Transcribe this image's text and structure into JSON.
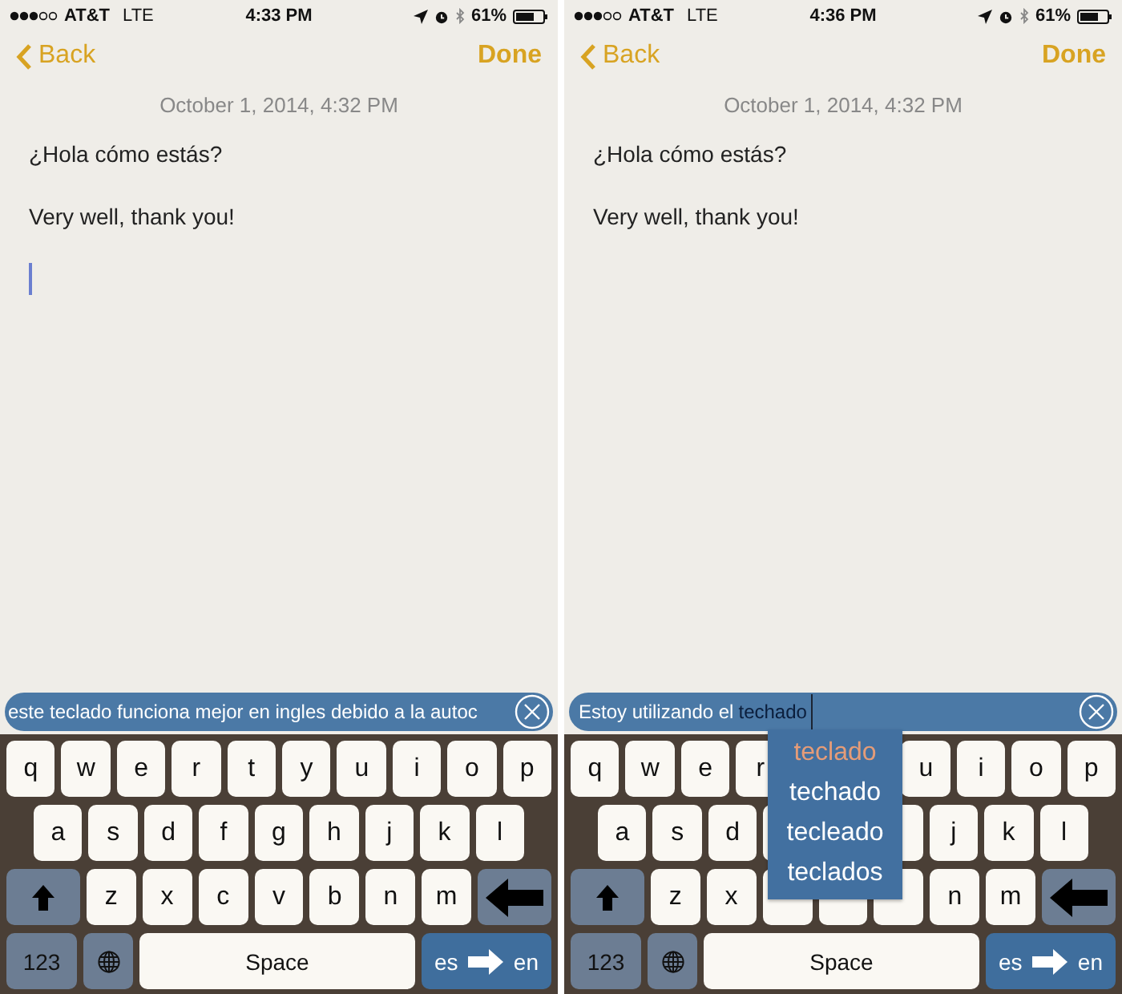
{
  "phones": [
    {
      "status": {
        "carrier": "AT&T",
        "network": "LTE",
        "time": "4:33 PM",
        "battery": "61%"
      },
      "nav": {
        "back": "Back",
        "done": "Done"
      },
      "date": "October 1, 2014, 4:32 PM",
      "lines": [
        "¿Hola cómo estás?",
        "Very well, thank you!"
      ],
      "text_cursor": true,
      "suggestion_bar": {
        "text": "este teclado funciona mejor en ingles debido a la autoc",
        "bar_cursor": false
      },
      "keyboard": {
        "top_letters": [
          {
            "kind": "letter",
            "label": "q"
          },
          {
            "kind": "letter",
            "label": "w"
          },
          {
            "kind": "letter",
            "label": "e"
          },
          {
            "kind": "letter",
            "label": "r"
          },
          {
            "kind": "letter",
            "label": "t"
          },
          {
            "kind": "letter",
            "label": "y"
          },
          {
            "kind": "letter",
            "label": "u"
          },
          {
            "kind": "letter",
            "label": "i"
          },
          {
            "kind": "letter",
            "label": "o"
          },
          {
            "kind": "letter",
            "label": "p"
          }
        ],
        "middle_letters": [
          {
            "kind": "letter",
            "label": "a"
          },
          {
            "kind": "letter",
            "label": "s"
          },
          {
            "kind": "letter",
            "label": "d"
          },
          {
            "kind": "letter",
            "label": "f"
          },
          {
            "kind": "letter",
            "label": "g"
          },
          {
            "kind": "letter",
            "label": "h"
          },
          {
            "kind": "letter",
            "label": "j"
          },
          {
            "kind": "letter",
            "label": "k"
          },
          {
            "kind": "letter",
            "label": "l"
          }
        ],
        "bottom_letters": [
          {
            "kind": "shift"
          },
          {
            "kind": "letter",
            "label": "z"
          },
          {
            "kind": "letter",
            "label": "x"
          },
          {
            "kind": "letter",
            "label": "c"
          },
          {
            "kind": "letter",
            "label": "v"
          },
          {
            "kind": "letter",
            "label": "b"
          },
          {
            "kind": "letter",
            "label": "n"
          },
          {
            "kind": "letter",
            "label": "m"
          },
          {
            "kind": "backspace"
          }
        ],
        "function_keys": [
          {
            "kind": "numbers",
            "label": "123"
          },
          {
            "kind": "globe"
          },
          {
            "kind": "space",
            "label": "Space"
          },
          {
            "kind": "language",
            "from": "es",
            "to": "en"
          }
        ]
      }
    },
    {
      "status": {
        "carrier": "AT&T",
        "network": "LTE",
        "time": "4:36 PM",
        "battery": "61%"
      },
      "nav": {
        "back": "Back",
        "done": "Done"
      },
      "date": "October 1, 2014, 4:32 PM",
      "lines": [
        "¿Hola cómo estás?",
        "Very well, thank you!"
      ],
      "text_cursor": false,
      "suggestion_bar": {
        "text": "Estoy utilizando el",
        "word": "techado",
        "bar_cursor": true
      },
      "keyboard": {
        "top_letters": [
          {
            "kind": "letter",
            "label": "q"
          },
          {
            "kind": "letter",
            "label": "w"
          },
          {
            "kind": "letter",
            "label": "e"
          },
          {
            "kind": "letter",
            "label": "r"
          },
          {
            "kind": "covered"
          },
          {
            "kind": "covered"
          },
          {
            "kind": "letter",
            "label": "u"
          },
          {
            "kind": "letter",
            "label": "i"
          },
          {
            "kind": "letter",
            "label": "o"
          },
          {
            "kind": "letter",
            "label": "p"
          }
        ],
        "middle_letters": [
          {
            "kind": "letter",
            "label": "a"
          },
          {
            "kind": "letter",
            "label": "s"
          },
          {
            "kind": "letter",
            "label": "d"
          },
          {
            "kind": "letter"
          },
          {
            "kind": "covered"
          },
          {
            "kind": "letter"
          },
          {
            "kind": "letter",
            "label": "j"
          },
          {
            "kind": "letter",
            "label": "k"
          },
          {
            "kind": "letter",
            "label": "l"
          }
        ],
        "bottom_letters": [
          {
            "kind": "shift"
          },
          {
            "kind": "letter",
            "label": "z"
          },
          {
            "kind": "letter",
            "label": "x"
          },
          {
            "kind": "letter"
          },
          {
            "kind": "letter"
          },
          {
            "kind": "letter"
          },
          {
            "kind": "letter",
            "label": "n"
          },
          {
            "kind": "letter",
            "label": "m"
          },
          {
            "kind": "backspace"
          }
        ],
        "function_keys": [
          {
            "kind": "numbers",
            "label": "123"
          },
          {
            "kind": "globe"
          },
          {
            "kind": "space",
            "label": "Space"
          },
          {
            "kind": "language",
            "from": "es",
            "to": "en"
          }
        ]
      },
      "popup": {
        "options": [
          {
            "label": "teclado",
            "selected": true
          },
          {
            "label": "techado",
            "selected": false
          },
          {
            "label": "tecleado",
            "selected": false
          },
          {
            "label": "teclados",
            "selected": false
          }
        ]
      }
    }
  ]
}
